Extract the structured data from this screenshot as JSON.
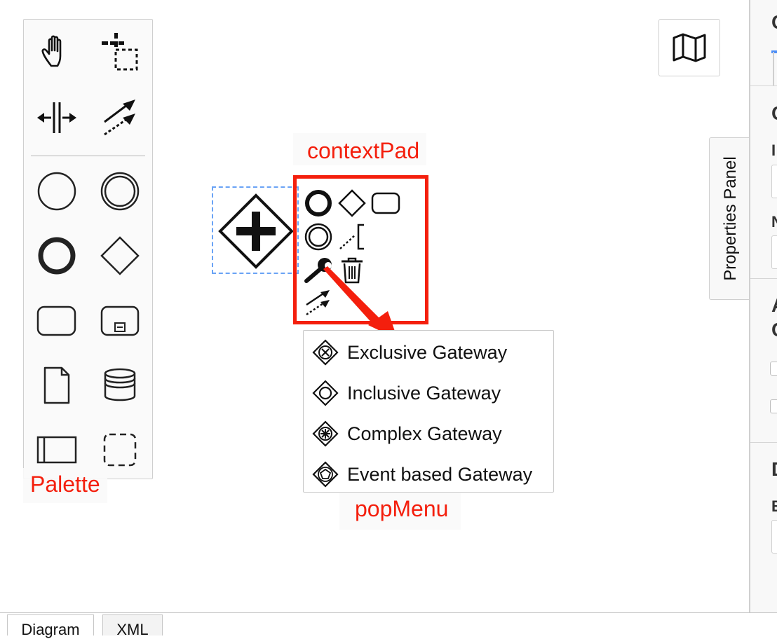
{
  "palette": {
    "annotation": "Palette",
    "tools": [
      {
        "name": "hand-tool",
        "icon": "hand-icon"
      },
      {
        "name": "lasso-tool",
        "icon": "lasso-icon"
      },
      {
        "name": "space-tool",
        "icon": "space-icon"
      },
      {
        "name": "global-connect-tool",
        "icon": "connect-icon"
      },
      {
        "name": "create-start-event",
        "icon": "start-event-icon"
      },
      {
        "name": "create-intermediate-event",
        "icon": "intermediate-event-icon"
      },
      {
        "name": "create-end-event",
        "icon": "end-event-icon"
      },
      {
        "name": "create-gateway",
        "icon": "gateway-icon"
      },
      {
        "name": "create-task",
        "icon": "task-icon"
      },
      {
        "name": "create-subprocess",
        "icon": "subprocess-icon"
      },
      {
        "name": "create-data-object",
        "icon": "data-object-icon"
      },
      {
        "name": "create-data-store",
        "icon": "data-store-icon"
      },
      {
        "name": "create-pool",
        "icon": "pool-icon"
      },
      {
        "name": "create-group",
        "icon": "group-icon"
      }
    ]
  },
  "minimap": {
    "icon": "map-icon"
  },
  "canvas": {
    "selected_element": "parallel-gateway"
  },
  "contextPad": {
    "annotation": "contextPad",
    "entries": [
      {
        "name": "append-end-event",
        "icon": "end-event-icon"
      },
      {
        "name": "append-gateway",
        "icon": "gateway-icon"
      },
      {
        "name": "append-task",
        "icon": "task-icon"
      },
      {
        "name": "append-intermediate-event",
        "icon": "intermediate-event-icon"
      },
      {
        "name": "append-text-annotation",
        "icon": "text-annotation-icon"
      },
      {
        "name": "replace",
        "icon": "wrench-icon"
      },
      {
        "name": "delete",
        "icon": "trash-icon"
      },
      {
        "name": "connect",
        "icon": "connect-icon"
      }
    ]
  },
  "popMenu": {
    "annotation": "popMenu",
    "items": [
      {
        "label": "Exclusive Gateway",
        "icon": "exclusive-gateway-icon"
      },
      {
        "label": "Inclusive Gateway",
        "icon": "inclusive-gateway-icon"
      },
      {
        "label": "Complex Gateway",
        "icon": "complex-gateway-icon"
      },
      {
        "label": "Event based Gateway",
        "icon": "event-based-gateway-icon"
      }
    ]
  },
  "propertiesPanel": {
    "toggle_label": "Properties Panel",
    "visible_letters": [
      "C",
      "C",
      "I",
      "N",
      "A",
      "C",
      "D",
      "E"
    ]
  },
  "bottomTabs": [
    "Diagram",
    "XML"
  ],
  "colors": {
    "annotation": "#f41f0d",
    "selection": "#6aa3f5"
  }
}
